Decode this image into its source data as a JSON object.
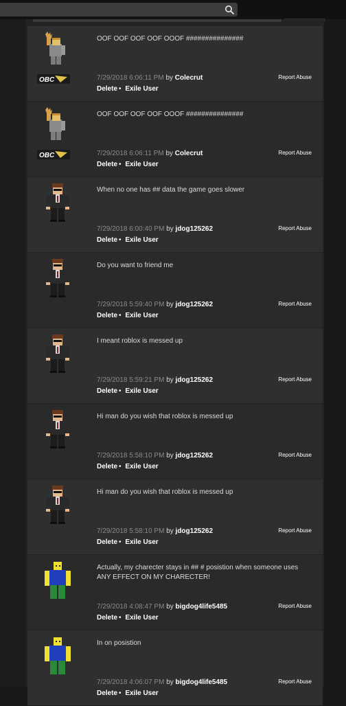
{
  "search": {
    "placeholder": ""
  },
  "posts": [
    {
      "avatar": "obc",
      "body": "OOF OOF OOF OOF OOOF ###############",
      "timestamp": "7/29/2018 6:06:11 PM",
      "by": "by",
      "user": "Colecrut",
      "report": "Report Abuse",
      "delete": "Delete",
      "exile": "Exile User"
    },
    {
      "avatar": "obc",
      "body": "OOF OOF OOF OOF OOOF ###############",
      "timestamp": "7/29/2018 6:06:11 PM",
      "by": "by",
      "user": "Colecrut",
      "report": "Report Abuse",
      "delete": "Delete",
      "exile": "Exile User"
    },
    {
      "avatar": "suit",
      "body": "When no one has ## data the game goes slower",
      "timestamp": "7/29/2018 6:00:40 PM",
      "by": "by",
      "user": "jdog125262",
      "report": "Report Abuse",
      "delete": "Delete",
      "exile": "Exile User"
    },
    {
      "avatar": "suit",
      "body": "Do you want to friend me",
      "timestamp": "7/29/2018 5:59:40 PM",
      "by": "by",
      "user": "jdog125262",
      "report": "Report Abuse",
      "delete": "Delete",
      "exile": "Exile User"
    },
    {
      "avatar": "suit",
      "body": "I meant roblox is messed up",
      "timestamp": "7/29/2018 5:59:21 PM",
      "by": "by",
      "user": "jdog125262",
      "report": "Report Abuse",
      "delete": "Delete",
      "exile": "Exile User"
    },
    {
      "avatar": "suit",
      "body": "Hi man do you wish that roblox is messed up",
      "timestamp": "7/29/2018 5:58:10 PM",
      "by": "by",
      "user": "jdog125262",
      "report": "Report Abuse",
      "delete": "Delete",
      "exile": "Exile User"
    },
    {
      "avatar": "suit",
      "body": "Hi man do you wish that roblox is messed up",
      "timestamp": "7/29/2018 5:58:10 PM",
      "by": "by",
      "user": "jdog125262",
      "report": "Report Abuse",
      "delete": "Delete",
      "exile": "Exile User"
    },
    {
      "avatar": "noob",
      "body": "Actually, my charecter stays in ## # posistion when someone uses ANY EFFECT ON MY CHARECTER!",
      "timestamp": "7/29/2018 4:08:47 PM",
      "by": "by",
      "user": "bigdog4life5485",
      "report": "Report Abuse",
      "delete": "Delete",
      "exile": "Exile User"
    },
    {
      "avatar": "noob",
      "body": "In on posistion",
      "timestamp": "7/29/2018 4:06:07 PM",
      "by": "by",
      "user": "bigdog4life5485",
      "report": "Report Abuse",
      "delete": "Delete",
      "exile": "Exile User"
    }
  ]
}
